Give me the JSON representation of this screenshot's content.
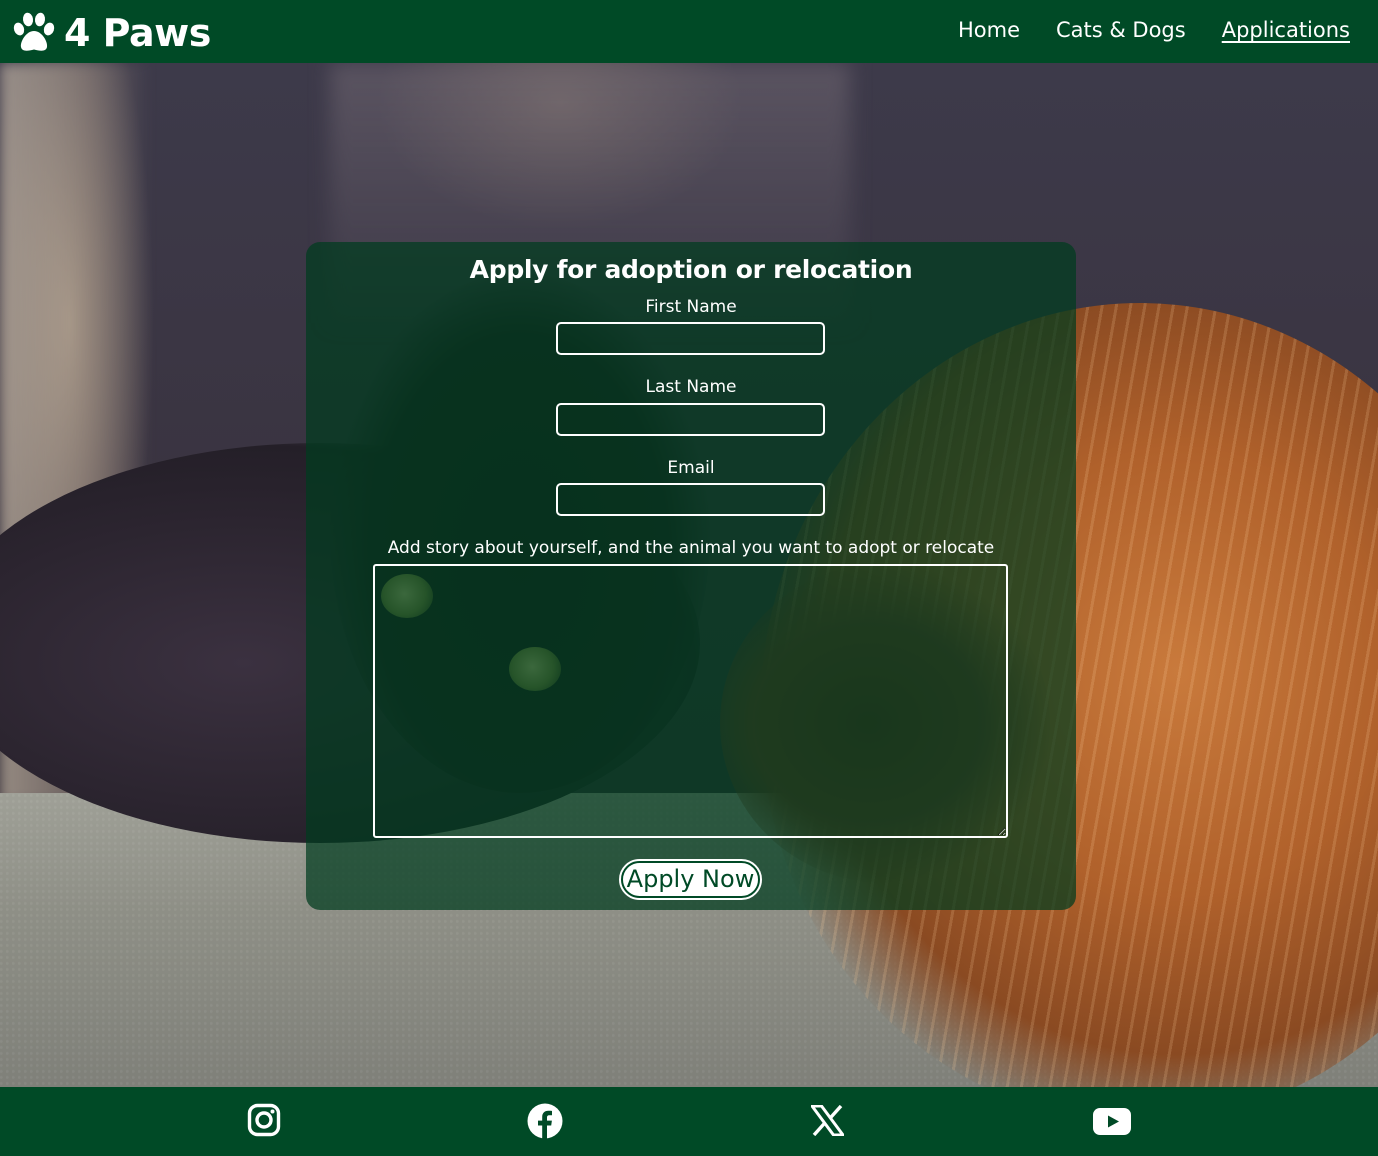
{
  "brand": {
    "name": "4 Paws",
    "icon": "paw-icon"
  },
  "nav": {
    "items": [
      {
        "label": "Home",
        "active": false
      },
      {
        "label": "Cats & Dogs",
        "active": false
      },
      {
        "label": "Applications",
        "active": true
      }
    ]
  },
  "form": {
    "title": "Apply for adoption or relocation",
    "first_name": {
      "label": "First Name",
      "value": "",
      "placeholder": ""
    },
    "last_name": {
      "label": "Last Name",
      "value": "",
      "placeholder": ""
    },
    "email": {
      "label": "Email",
      "value": "",
      "placeholder": ""
    },
    "story": {
      "label": "Add story about yourself, and the animal you want to adopt or relocate",
      "value": ""
    },
    "submit_label": "Apply Now"
  },
  "footer": {
    "social": [
      {
        "icon": "instagram-icon"
      },
      {
        "icon": "facebook-icon"
      },
      {
        "icon": "x-icon"
      },
      {
        "icon": "youtube-icon"
      }
    ]
  },
  "colors": {
    "header_bg": "#004a26",
    "card_bg": "rgba(0,60,30,0.72)",
    "text": "#ffffff"
  }
}
